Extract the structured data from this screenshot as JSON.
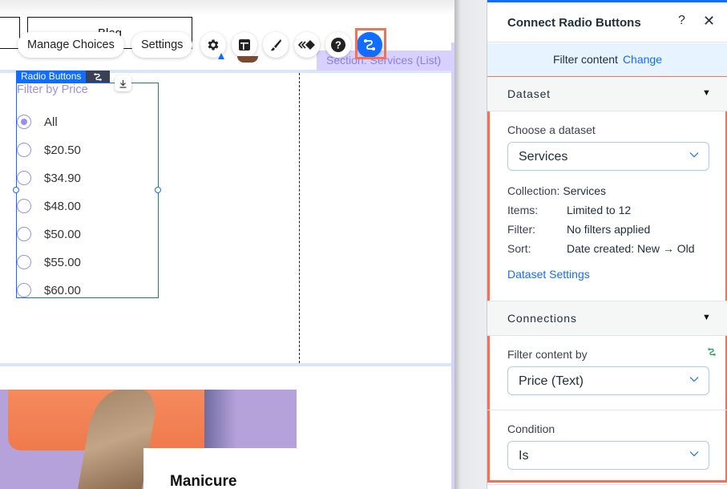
{
  "canvas": {
    "site_nav": {
      "blog_label": "Blog"
    },
    "floating_toolbar": {
      "manage_choices_label": "Manage Choices",
      "settings_label": "Settings",
      "icons": [
        "gear-icon",
        "layout-icon",
        "paint-brush-icon",
        "animation-icon",
        "help-icon",
        "connect-to-data-icon"
      ],
      "active_icon": "connect-to-data-icon"
    },
    "section_label": "Section: Services (List)",
    "radio_buttons": {
      "tag_label": "Radio Buttons",
      "title": "Filter by Price",
      "selected_index": 0,
      "options": [
        "All",
        "$20.50",
        "$34.90",
        "$48.00",
        "$50.00",
        "$55.00",
        "$60.00"
      ]
    },
    "service_card": {
      "title": "Manicure"
    }
  },
  "panel": {
    "title": "Connect Radio Buttons",
    "help_icon": "?",
    "close_icon": "✕",
    "info_bar": {
      "text": "Filter content",
      "link": "Change"
    },
    "dataset_section": {
      "heading": "Dataset",
      "choose_label": "Choose a dataset",
      "selected_dataset": "Services",
      "details": [
        {
          "key": "Collection:",
          "value": "Services"
        },
        {
          "key": "Items:",
          "value": "Limited to 12"
        },
        {
          "key": "Filter:",
          "value": "No filters applied"
        },
        {
          "key": "Sort:",
          "value": "Date created: New → Old"
        }
      ],
      "settings_link": "Dataset Settings"
    },
    "connections_section": {
      "heading": "Connections",
      "filter_by_label": "Filter content by",
      "filter_by_value": "Price (Text)",
      "condition_label": "Condition",
      "condition_value": "Is"
    }
  },
  "colors": {
    "accent_blue": "#116dff",
    "highlight_orange": "#f96f4f",
    "radio_purple": "#9b8ef3",
    "section_label_bg": "#d9d1fd",
    "connected_green": "#25a55f"
  }
}
